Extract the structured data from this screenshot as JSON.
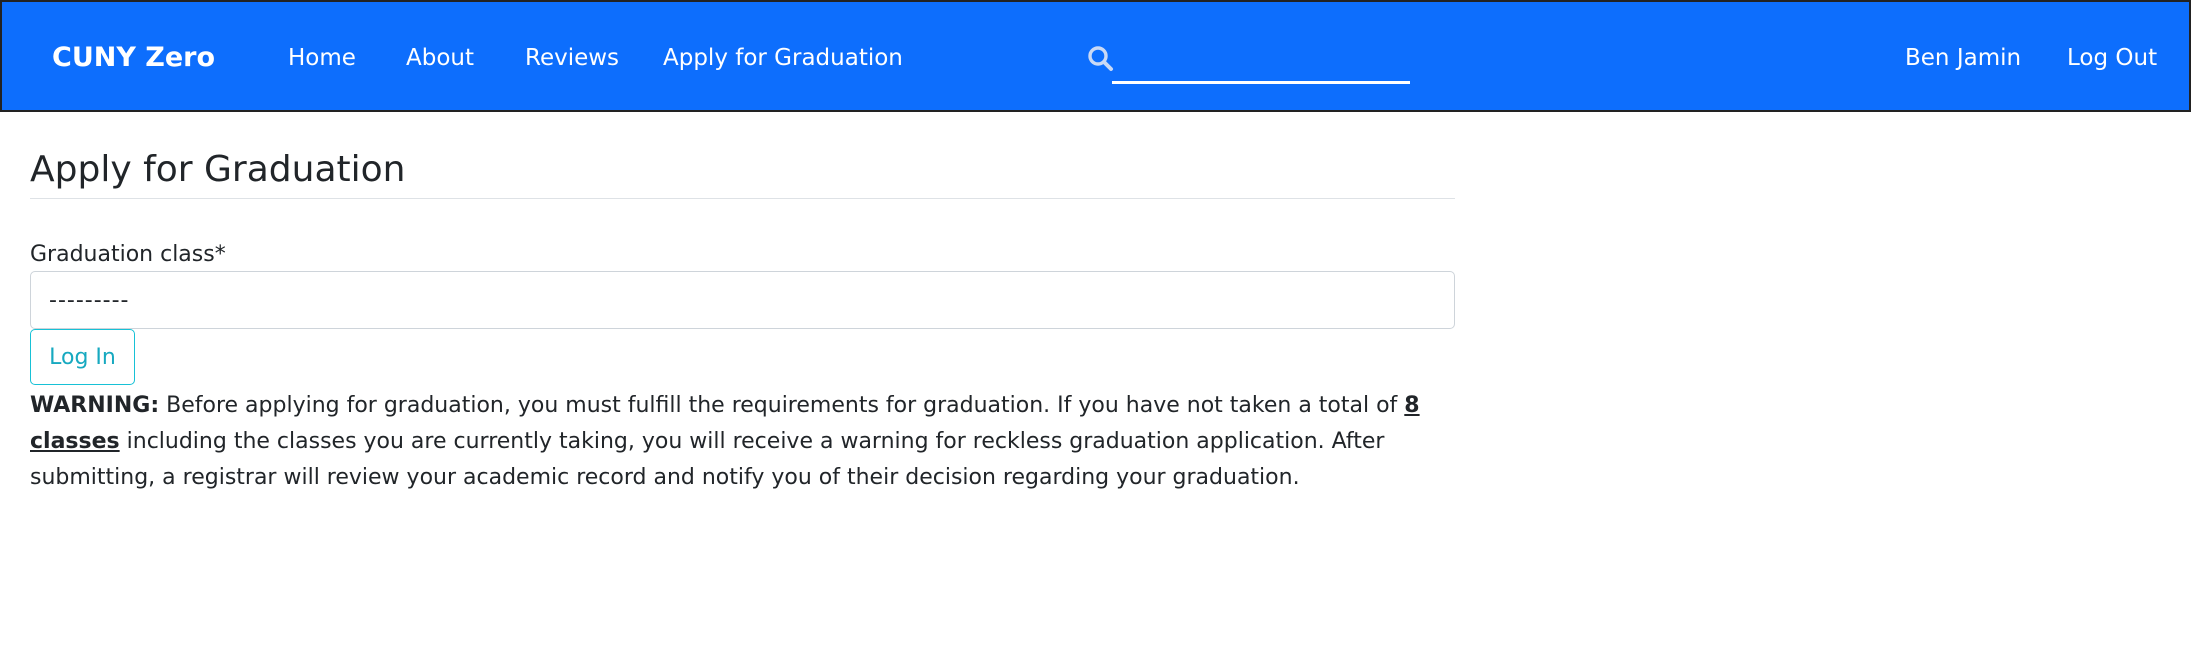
{
  "navbar": {
    "brand": "CUNY Zero",
    "links": [
      "Home",
      "About",
      "Reviews",
      "Apply for Graduation"
    ],
    "search": {
      "value": "",
      "placeholder": ""
    },
    "user_name": "Ben Jamin",
    "logout_label": "Log Out",
    "background_color": "#0d6efd"
  },
  "main": {
    "title": "Apply for Graduation",
    "form": {
      "label": "Graduation class*",
      "select_value": "---------",
      "submit_label": "Log In"
    },
    "warning": {
      "prefix": "WARNING:",
      "text_before": " Before applying for graduation, you must fulfill the requirements for graduation. If you have not taken a total of ",
      "emphasis": "8 classes",
      "text_after": " including the classes you are currently taking, you will receive a warning for reckless graduation application. After submitting, a registrar will review your academic record and notify you of their decision regarding your graduation."
    }
  }
}
